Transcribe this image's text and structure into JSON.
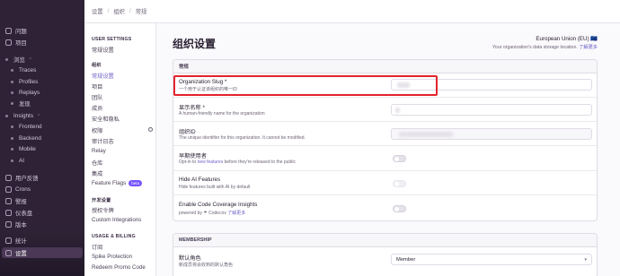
{
  "breadcrumb": [
    "设置",
    "组织",
    "常规"
  ],
  "nav": {
    "items": [
      {
        "label": "问题",
        "icon": "issues-icon"
      },
      {
        "label": "项目",
        "icon": "projects-icon"
      },
      {
        "label": "浏览",
        "icon": "explore-icon"
      },
      {
        "label": "Traces"
      },
      {
        "label": "Profiles"
      },
      {
        "label": "Replays"
      },
      {
        "label": "发现"
      },
      {
        "label": "Insights",
        "icon": "insights-icon"
      },
      {
        "label": "Frontend"
      },
      {
        "label": "Backend"
      },
      {
        "label": "Mobile"
      },
      {
        "label": "AI"
      },
      {
        "label": "用户反馈",
        "icon": "feedback-icon"
      },
      {
        "label": "Crons",
        "icon": "crons-icon"
      },
      {
        "label": "警报",
        "icon": "alerts-icon"
      },
      {
        "label": "仪表盘",
        "icon": "dashboards-icon"
      },
      {
        "label": "版本",
        "icon": "releases-icon"
      },
      {
        "label": "统计",
        "icon": "stats-icon"
      },
      {
        "label": "设置",
        "icon": "settings-icon"
      }
    ]
  },
  "sidebar": {
    "user_heading": "USER SETTINGS",
    "user_items": [
      "常规设置"
    ],
    "org_heading": "组织",
    "org_items": [
      "常规设置",
      "项目",
      "团队",
      "成员",
      "安全和隐私",
      "权限",
      "审计日志",
      "Relay",
      "仓库",
      "集成",
      "Feature Flags"
    ],
    "beta": "beta",
    "dev_heading": "开发设置",
    "dev_items": [
      "授权令牌",
      "Custom Integrations"
    ],
    "billing_heading": "USAGE & BILLING",
    "billing_items": [
      "订阅",
      "Spike Protection",
      "Redeem Promo Code"
    ]
  },
  "main": {
    "title": "组织设置",
    "region": "European Union (EU) 🇪🇺",
    "region_desc": "Your organization's data storage location.",
    "region_link": "了解更多",
    "general_heading": "常规",
    "slug_label": "Organization Slug *",
    "slug_desc": "一个用于认证该组织的唯一ID",
    "name_label": "显示名称 *",
    "name_desc": "A human-friendly name for the organization",
    "id_label": "组织ID",
    "id_desc": "The unique identifier for this organization. It cannot be modified.",
    "early_label": "早期使用者",
    "early_desc_pre": "Opt-in to",
    "early_desc_link": "new features",
    "early_desc_post": "before they're released to the public",
    "hide_ai_label": "Hide AI Features",
    "hide_ai_desc": "Hide features built with AI by default",
    "coverage_label": "Enable Code Coverage Insights",
    "coverage_desc_pre": "powered by",
    "coverage_desc_brand": "Codecov",
    "coverage_desc_link": "了解更多",
    "membership_heading": "MEMBERSHIP",
    "role_label": "默认角色",
    "role_desc": "新成员将会收到的默认角色",
    "role_value": "Member"
  },
  "colors": {
    "highlight": "#e3232c",
    "accent": "#6c5fc7",
    "nav_bg": "#2f2236"
  }
}
